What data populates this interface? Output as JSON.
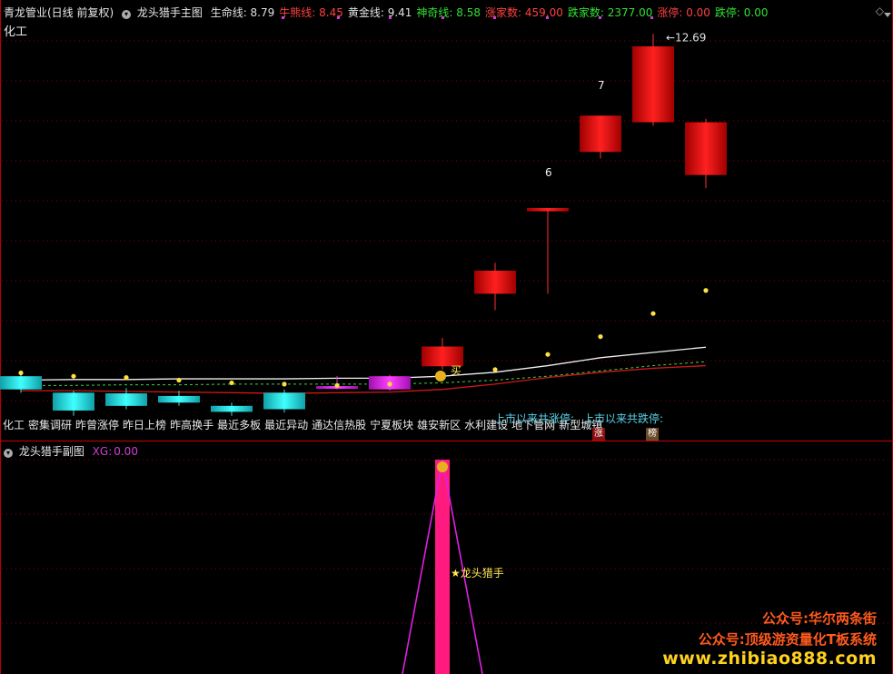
{
  "header": {
    "stock_title": "青龙管业(日线 前复权)",
    "indicator_name": "龙头猎手主图",
    "items": [
      {
        "label": "生命线:",
        "value": "8.79",
        "color": "#e0e0e0"
      },
      {
        "label": "牛熊线:",
        "value": "8.45",
        "color": "#ff4040"
      },
      {
        "label": "黄金线:",
        "value": "9.41",
        "color": "#e0e0e0"
      },
      {
        "label": "神奇线:",
        "value": "8.58",
        "color": "#32e032"
      },
      {
        "label": "涨家数:",
        "value": "459.00",
        "color": "#ff4040"
      },
      {
        "label": "跌家数:",
        "value": "2377.00",
        "color": "#32e032"
      },
      {
        "label": "涨停:",
        "value": "0.00",
        "color": "#ff4040"
      },
      {
        "label": "跌停:",
        "value": "0.00",
        "color": "#32e032"
      }
    ],
    "right_icon": "diamond-icon"
  },
  "main_chart": {
    "sector_label": "化工",
    "high_label": "12.69",
    "count_labels": [
      "6",
      "7"
    ],
    "buy_label": "买",
    "tags": [
      "化工",
      "密集调研",
      "昨曾涨停",
      "昨日上榜",
      "昨高换手",
      "最近多板",
      "最近异动",
      "通达信热股",
      "宁夏板块",
      "雄安新区",
      "水利建设",
      "地下管网",
      "新型城镇"
    ],
    "overlay_up": "上市以来共涨停:",
    "overlay_down": "上市以来共跌停:",
    "badge_up": "涨",
    "badge_list": "榜"
  },
  "chart_data": {
    "type": "candlestick",
    "price_range": [
      6.8,
      12.9
    ],
    "candles": [
      {
        "open": 7.5,
        "close": 7.3,
        "high": 7.58,
        "low": 7.25,
        "color": "cyan"
      },
      {
        "open": 7.25,
        "close": 6.98,
        "high": 7.28,
        "low": 6.9,
        "color": "cyan"
      },
      {
        "open": 7.24,
        "close": 7.05,
        "high": 7.32,
        "low": 7.0,
        "color": "cyan"
      },
      {
        "open": 7.2,
        "close": 7.1,
        "high": 7.28,
        "low": 7.05,
        "color": "cyan"
      },
      {
        "open": 7.05,
        "close": 6.96,
        "high": 7.1,
        "low": 6.9,
        "color": "cyan"
      },
      {
        "open": 7.25,
        "close": 7.0,
        "high": 7.3,
        "low": 6.95,
        "color": "cyan"
      },
      {
        "open": 7.35,
        "close": 7.32,
        "high": 7.5,
        "low": 7.3,
        "color": "magenta"
      },
      {
        "open": 7.3,
        "close": 7.5,
        "high": 7.52,
        "low": 7.28,
        "color": "magenta"
      },
      {
        "open": 7.65,
        "close": 7.95,
        "high": 8.08,
        "low": 7.6,
        "color": "red"
      },
      {
        "open": 8.75,
        "close": 9.1,
        "high": 9.22,
        "low": 8.5,
        "color": "red"
      },
      {
        "open": 10.0,
        "close": 10.05,
        "high": 10.05,
        "low": 8.75,
        "color": "red"
      },
      {
        "open": 10.9,
        "close": 11.45,
        "high": 11.45,
        "low": 10.8,
        "color": "red"
      },
      {
        "open": 11.35,
        "close": 12.5,
        "high": 12.69,
        "low": 11.3,
        "color": "red"
      },
      {
        "open": 10.55,
        "close": 11.35,
        "high": 11.4,
        "low": 10.35,
        "color": "red"
      }
    ],
    "yellow_dots": [
      7.55,
      7.5,
      7.48,
      7.44,
      7.4,
      7.38,
      7.36,
      7.38,
      7.5,
      7.6,
      7.83,
      8.1,
      8.45,
      8.8
    ],
    "white_line": [
      7.44,
      7.45,
      7.45,
      7.46,
      7.46,
      7.46,
      7.47,
      7.47,
      7.5,
      7.56,
      7.66,
      7.78,
      7.86,
      7.94
    ],
    "green_dashed_line": [
      7.36,
      7.36,
      7.37,
      7.37,
      7.38,
      7.38,
      7.38,
      7.38,
      7.4,
      7.44,
      7.5,
      7.58,
      7.66,
      7.72
    ],
    "red_line": [
      7.28,
      7.28,
      7.27,
      7.26,
      7.25,
      7.24,
      7.25,
      7.26,
      7.3,
      7.38,
      7.48,
      7.56,
      7.62,
      7.66
    ]
  },
  "sub_chart": {
    "title": "龙头猎手副图",
    "xg_label": "XG:",
    "xg_value": "0.00",
    "signal_label": "★龙头猎手",
    "bag_icon": "money-bag-icon"
  },
  "watermark": {
    "line1": "公众号:华尔两条街",
    "line2": "公众号:顶级游资量化T板系统",
    "line3": "www.zhibiao888.com"
  }
}
